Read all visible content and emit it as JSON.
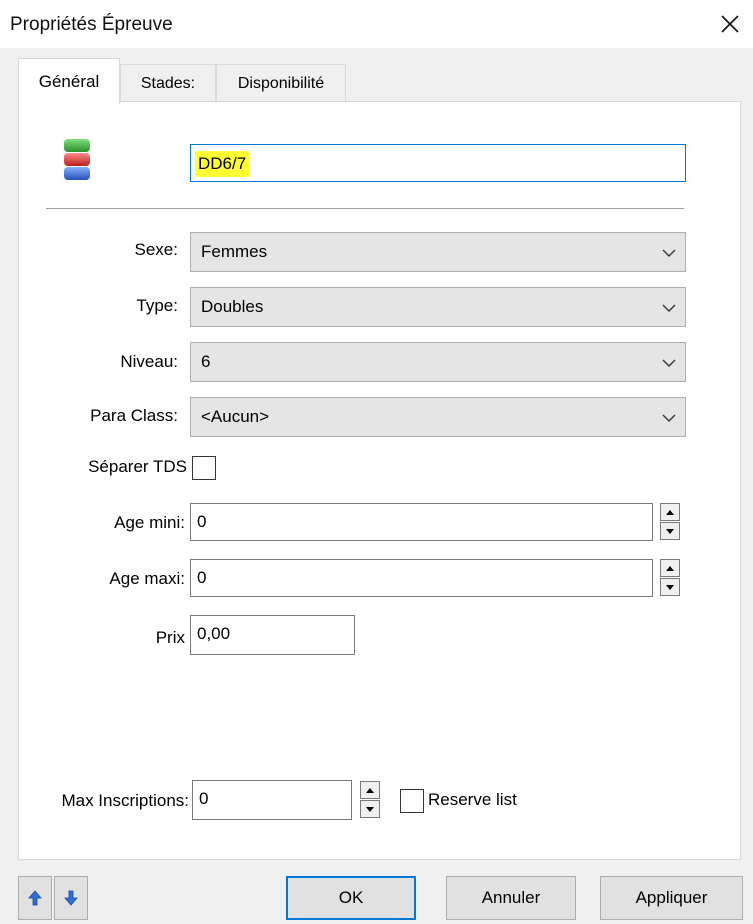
{
  "window": {
    "title": "Propriétés Épreuve"
  },
  "tabs": [
    {
      "label": "Général",
      "active": true
    },
    {
      "label": "Stades:"
    },
    {
      "label": "Disponibilité"
    }
  ],
  "general": {
    "name_value": "DD6/7",
    "sexe": {
      "label": "Sexe:",
      "value": "Femmes"
    },
    "type": {
      "label": "Type:",
      "value": "Doubles"
    },
    "niveau": {
      "label": "Niveau:",
      "value": "6"
    },
    "para_class": {
      "label": "Para Class:",
      "value": "<Aucun>"
    },
    "separer_tds": {
      "label": "Séparer TDS",
      "checked": false
    },
    "age_mini": {
      "label": "Age mini:",
      "value": "0"
    },
    "age_maxi": {
      "label": "Age maxi:",
      "value": "0"
    },
    "prix": {
      "label": "Prix",
      "value": "0,00"
    },
    "max_inscriptions": {
      "label": "Max Inscriptions:",
      "value": "0"
    },
    "reserve_list": {
      "label": "Reserve list",
      "checked": false
    }
  },
  "buttons": {
    "ok": "OK",
    "cancel": "Annuler",
    "apply": "Appliquer"
  },
  "icons": {
    "close": "close-icon",
    "event": "event-stack-icon",
    "move_up": "arrow-up-icon",
    "move_down": "arrow-down-icon",
    "dropdown": "chevron-down-icon"
  },
  "colors": {
    "accent": "#0078d7",
    "highlight": "#ffff33",
    "icon_green": "#3aa83a",
    "icon_red": "#d43a3a",
    "icon_blue": "#3a6fd4",
    "nav_arrow": "#2f6fd6"
  }
}
